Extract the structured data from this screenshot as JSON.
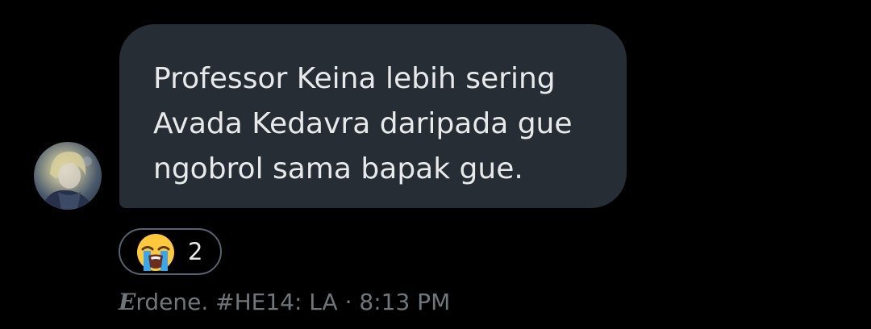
{
  "message": {
    "text": "Professor Keina lebih sering\nAvada Kedavra daripada gue\nngobrol sama bapak gue."
  },
  "reaction": {
    "emoji_icon": "loudly-crying-face-icon",
    "count": "2"
  },
  "sender": {
    "name_initial": "E",
    "name_rest": "rdene. #HE14: LA",
    "separator": " · ",
    "time": "8:13 PM"
  },
  "colors": {
    "background": "#000000",
    "bubble": "#262d34",
    "text": "#e7e9ea",
    "muted": "#71767b",
    "pill_border": "#536471"
  }
}
